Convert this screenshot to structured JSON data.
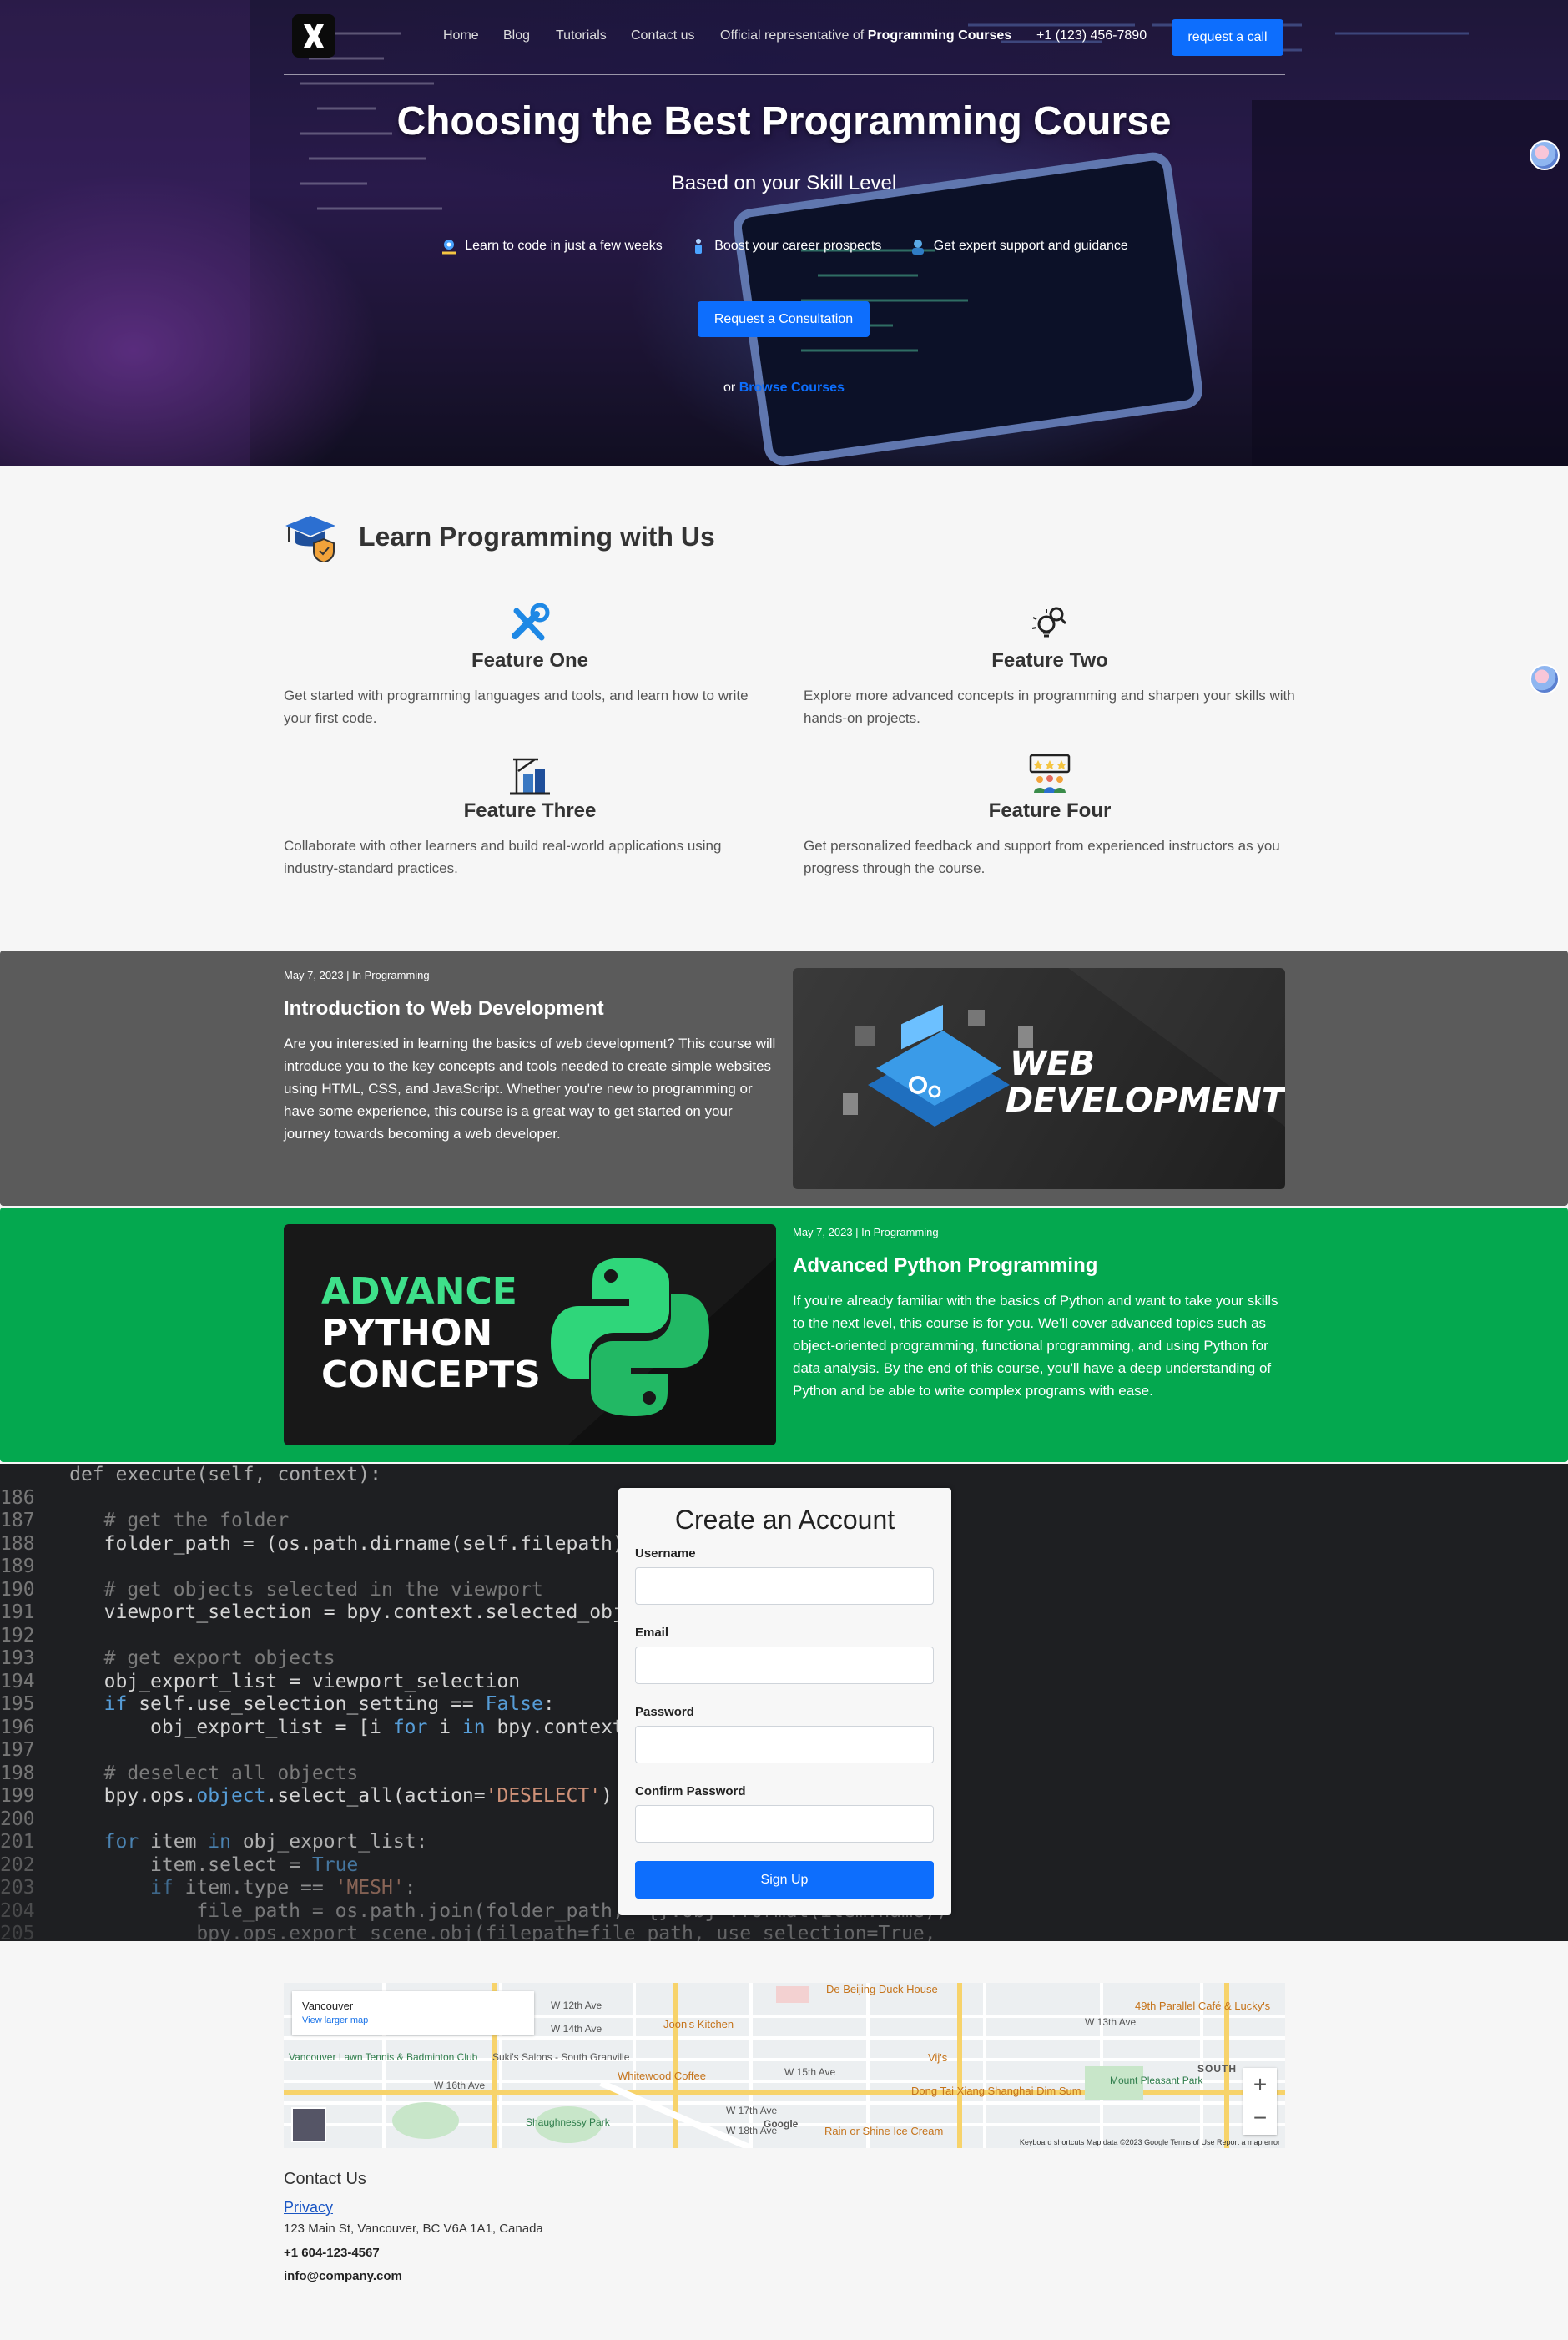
{
  "nav": {
    "links": [
      "Home",
      "Blog",
      "Tutorials",
      "Contact us"
    ],
    "rep_prefix": "Official representative of",
    "rep_brand": "Programming Courses",
    "phone": "+1 (123) 456-7890",
    "call_label": "request a call"
  },
  "hero": {
    "title": "Choosing the Best Programming Course",
    "subtitle": "Based on your Skill Level",
    "benefits": [
      "Learn to code in just a few weeks",
      "Boost your career prospects",
      "Get expert support and guidance"
    ],
    "cta": "Request a Consultation",
    "browse_prefix": "or",
    "browse_link": "Browse Courses"
  },
  "learn": {
    "title": "Learn Programming with Us",
    "features": [
      {
        "title": "Feature One",
        "text": "Get started with programming languages and tools, and learn how to write your first code.",
        "icon": "tools-icon"
      },
      {
        "title": "Feature Two",
        "text": "Explore more advanced concepts in programming and sharpen your skills with hands-on projects.",
        "icon": "lightbulb-search-icon"
      },
      {
        "title": "Feature Three",
        "text": "Collaborate with other learners and build real-world applications using industry-standard practices.",
        "icon": "buildings-crane-icon"
      },
      {
        "title": "Feature Four",
        "text": "Get personalized feedback and support from experienced instructors as you progress through the course.",
        "icon": "team-rating-icon"
      }
    ]
  },
  "courses": [
    {
      "meta": "May 7, 2023 | In Programming",
      "title": "Introduction to Web Development",
      "text": "Are you interested in learning the basics of web development? This course will introduce you to the key concepts and tools needed to create simple websites using HTML, CSS, and JavaScript. Whether you're new to programming or have some experience, this course is a great way to get started on your journey towards becoming a web developer.",
      "image_line1": "WEB",
      "image_line2": "DEVELOPMENT",
      "color": "#5b5b5b"
    },
    {
      "meta": "May 7, 2023 | In Programming",
      "title": "Advanced Python Programming",
      "text": "If you're already familiar with the basics of Python and want to take your skills to the next level, this course is for you. We'll cover advanced topics such as object-oriented programming, functional programming, and using Python for data analysis. By the end of this course, you'll have a deep understanding of Python and be able to write complex programs with ease.",
      "image_line1": "ADVANCE",
      "image_line2": "PYTHON",
      "image_line3": "CONCEPTS",
      "color": "#04a84f"
    }
  ],
  "signup": {
    "title": "Create an Account",
    "username_label": "Username",
    "email_label": "Email",
    "password_label": "Password",
    "confirm_label": "Confirm Password",
    "button": "Sign Up"
  },
  "map": {
    "place": "Vancouver",
    "larger": "View larger map",
    "labels": [
      "W 12th Ave",
      "W 14th Ave",
      "W 15th Ave",
      "W 16th Ave",
      "W 17th Ave",
      "W 18th Ave",
      "W 13th Ave",
      "SOUTH"
    ],
    "pois": [
      "Joon's Kitchen",
      "Whitewood Coffee",
      "De Beijing Duck House",
      "Dong Tai Xiang Shanghai Dim Sum",
      "Rain or Shine Ice Cream",
      "Vij's",
      "49th Parallel Café & Lucky's"
    ],
    "greens": [
      "Vancouver Lawn Tennis & Badminton Club",
      "Shaughnessy Park",
      "Mount Pleasant Park"
    ],
    "other": "Suki's Salons - South Granville",
    "footer": "Keyboard shortcuts   Map data ©2023 Google   Terms of Use   Report a map error",
    "google": "Google"
  },
  "contact": {
    "title": "Contact Us",
    "privacy": "Privacy",
    "address": "123 Main St, Vancouver, BC V6A 1A1, Canada",
    "phone": "+1 604-123-4567",
    "email": "info@company.com"
  },
  "colors": {
    "primary": "#0d6efd",
    "gray_band": "#5b5b5b",
    "green_band": "#04a84f"
  }
}
